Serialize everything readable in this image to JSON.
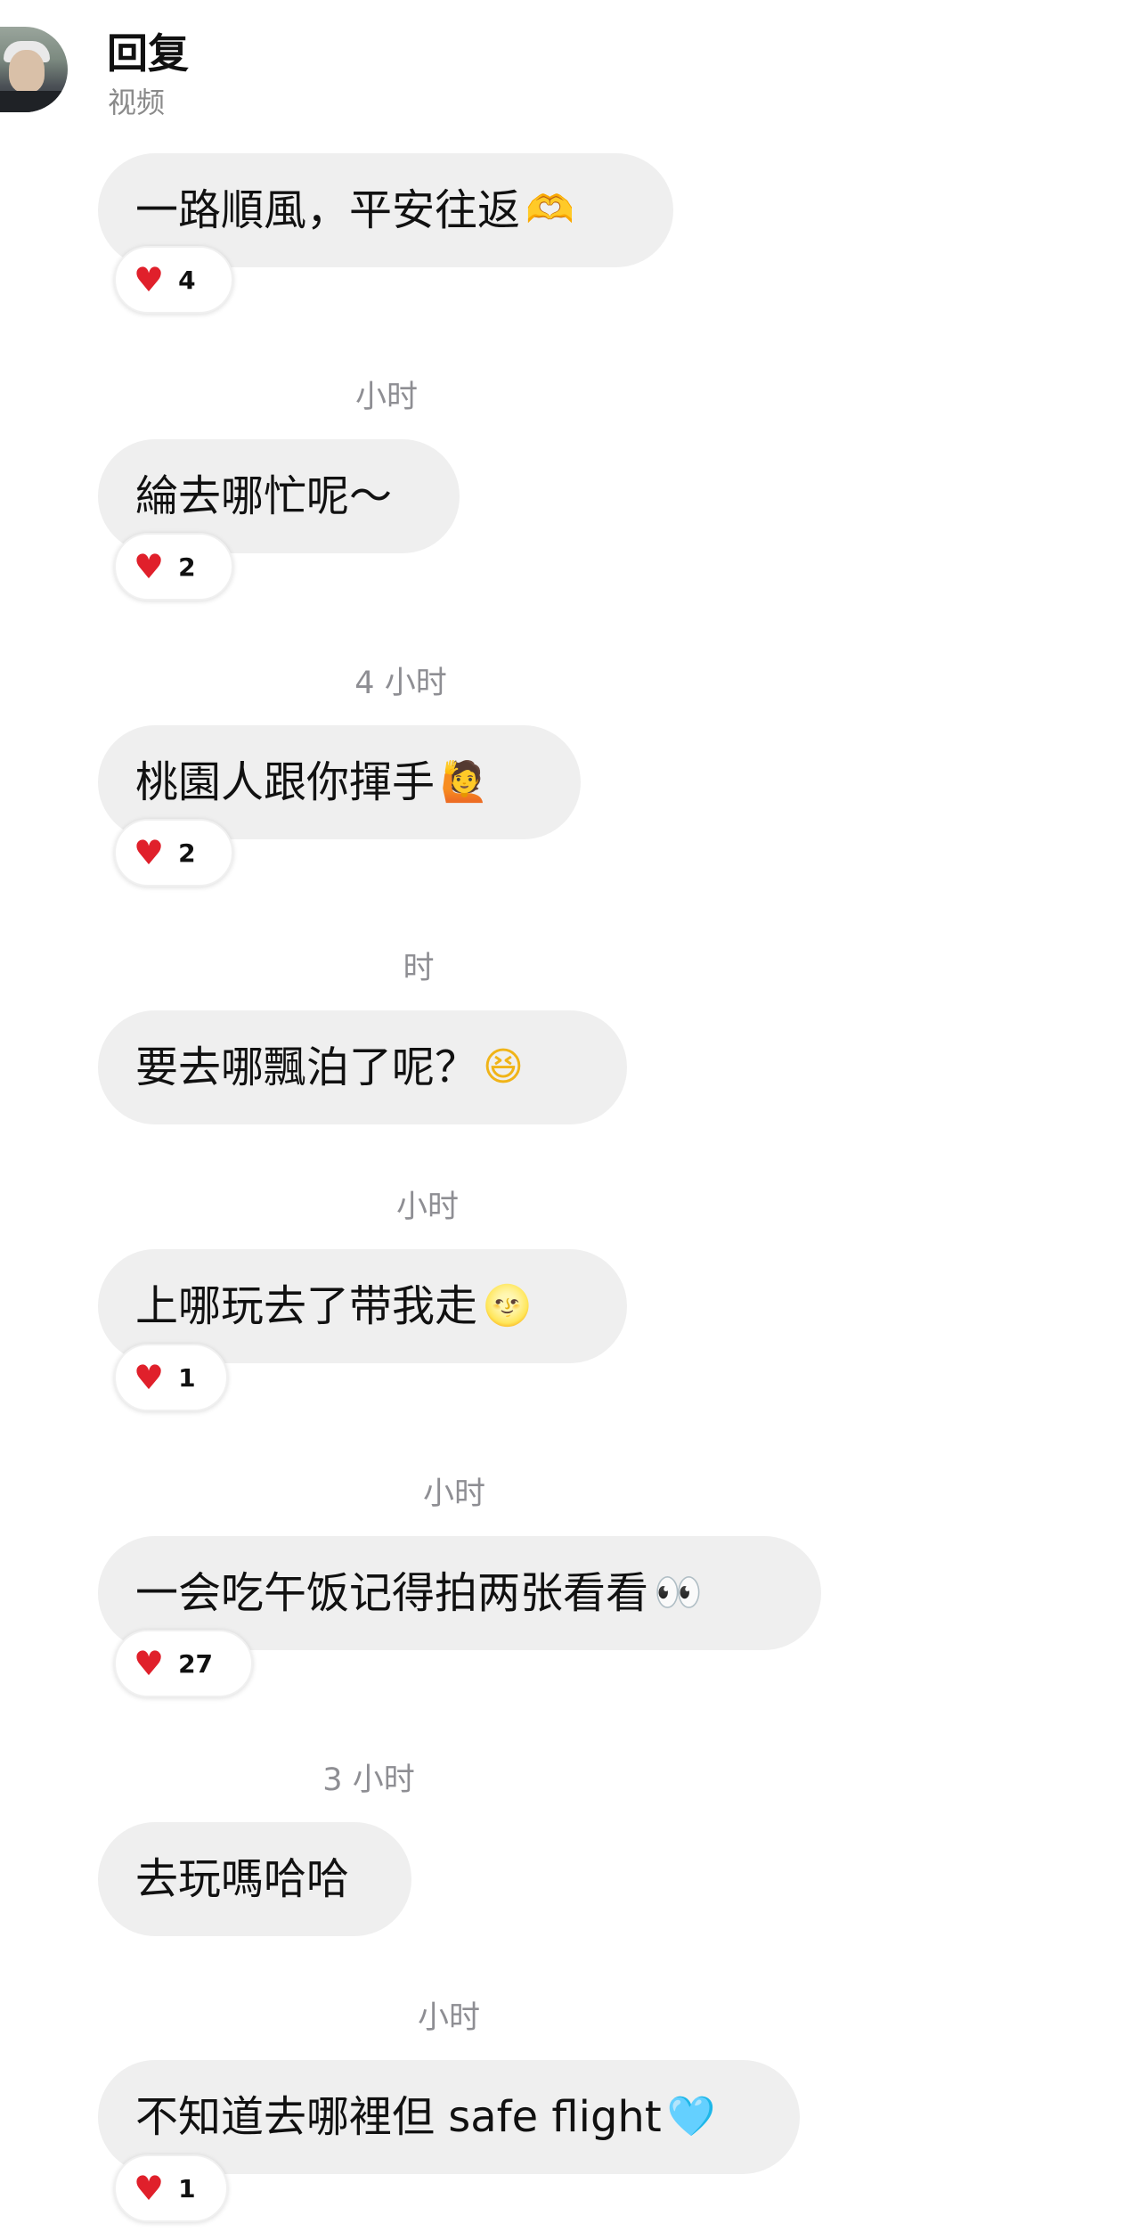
{
  "header": {
    "title": "回复",
    "subtitle": "视频"
  },
  "messages": [
    {
      "timestamp": "",
      "text": "一路順風，平安往返",
      "emoji": "🫶",
      "reaction_count": "4"
    },
    {
      "timestamp": "小时",
      "text": "綸去哪忙呢～",
      "emoji": "",
      "reaction_count": "2"
    },
    {
      "timestamp": "4 小时",
      "text": "桃園人跟你揮手",
      "emoji": "🙋",
      "reaction_count": "2"
    },
    {
      "timestamp": "时",
      "text": "要去哪飄泊了呢？",
      "emoji": "😆",
      "reaction_count": ""
    },
    {
      "timestamp": "小时",
      "text": "上哪玩去了带我走",
      "emoji": "🌝",
      "reaction_count": "1"
    },
    {
      "timestamp": "小时",
      "text": "一会吃午饭记得拍两张看看",
      "emoji": "👀",
      "reaction_count": "27"
    },
    {
      "timestamp": "3 小时",
      "text": "去玩嗎哈哈",
      "emoji": "",
      "reaction_count": ""
    },
    {
      "timestamp": "小时",
      "text": "不知道去哪裡但 safe flight",
      "emoji": "🩵",
      "reaction_count": "1"
    }
  ],
  "reaction_icon": "heart-icon",
  "colors": {
    "bubble": "#efefef",
    "heart": "#e0202b",
    "timestamp": "#8e8e93"
  }
}
